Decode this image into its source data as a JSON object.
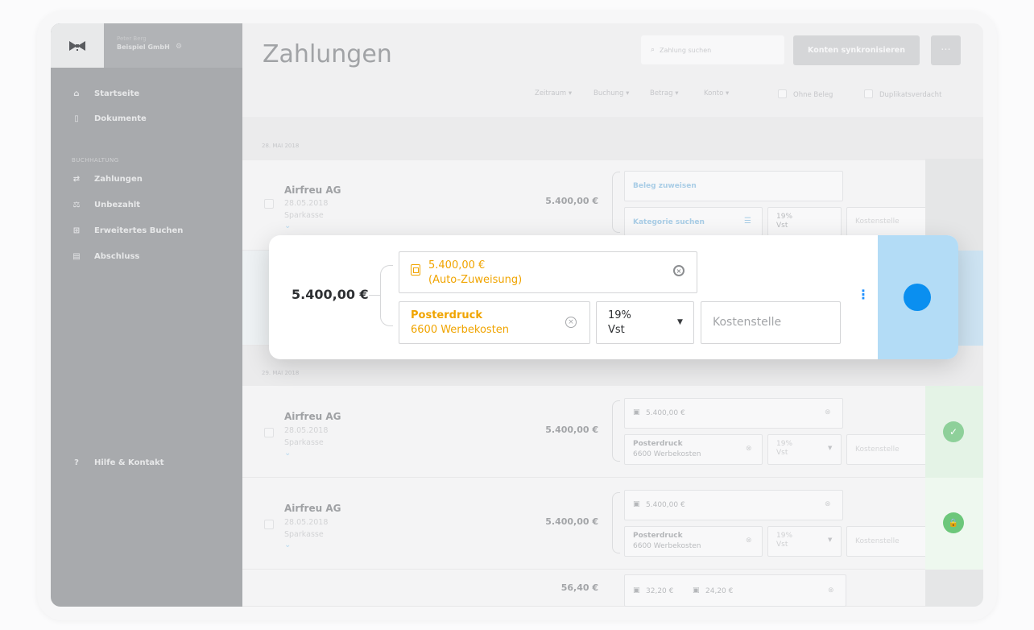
{
  "account": {
    "user": "Peter Berg",
    "company": "Beispiel GmbH"
  },
  "sidebar": {
    "items": [
      {
        "label": "Startseite",
        "icon": "home-icon"
      },
      {
        "label": "Dokumente",
        "icon": "document-icon"
      }
    ],
    "section_label": "BUCHHALTUNG",
    "accounting_items": [
      {
        "label": "Zahlungen",
        "icon": "transfer-icon"
      },
      {
        "label": "Unbezahlt",
        "icon": "scale-icon"
      },
      {
        "label": "Erweitertes Buchen",
        "icon": "grid-icon"
      },
      {
        "label": "Abschluss",
        "icon": "clipboard-icon"
      }
    ],
    "help": "Hilfe & Kontakt"
  },
  "header": {
    "title": "Zahlungen",
    "search_placeholder": "Zahlung suchen",
    "sync_label": "Konten synkronisieren",
    "more_label": "···"
  },
  "filters": {
    "zeitraum": "Zeitraum ▾",
    "buchung": "Buchung ▾",
    "betrag": "Betrag ▾",
    "konto": "Konto ▾",
    "ohne_beleg": "Ohne Beleg",
    "duplikat": "Duplikatsverdacht"
  },
  "sections": [
    "28. MAI 2018",
    "29. MAI 2018"
  ],
  "rows": [
    {
      "vendor": "Airfreu AG",
      "date": "28.05.2018",
      "bank": "Sparkasse",
      "amount": "5.400,00 €",
      "receipt": "Beleg zuweisen",
      "category": "Kategorie suchen",
      "vat_rate": "19%",
      "vat_label": "Vst",
      "cost": "Kostenstelle"
    },
    {
      "vendor": "Airfreu AG",
      "date": "28.05.2018",
      "bank": "Sparkasse",
      "amount": "5.400,00 €",
      "receipt": "5.400,00 €",
      "category": "Posterdruck",
      "account": "6600  Werbekosten",
      "vat_rate": "19%",
      "vat_label": "Vst",
      "cost": "Kostenstelle"
    },
    {
      "vendor": "Airfreu AG",
      "date": "28.05.2018",
      "bank": "Sparkasse",
      "amount": "5.400,00 €",
      "receipt": "5.400,00 €",
      "category": "Posterdruck",
      "account": "6600  Werbekosten",
      "vat_rate": "19%",
      "vat_label": "Vst",
      "cost": "Kostenstelle"
    },
    {
      "amount": "56,40 €",
      "receipt_a": "32,20 €",
      "receipt_b": "24,20 €"
    }
  ],
  "focus_card": {
    "amount": "5.400,00 €",
    "receipt_line1": "5.400,00 €",
    "receipt_line2": "(Auto-Zuweisung)",
    "category": "Posterdruck",
    "account": "6600  Werbekosten",
    "vat_rate": "19%",
    "vat_label": "Vst",
    "cost_placeholder": "Kostenstelle"
  },
  "colors": {
    "accent": "#0a8ff0",
    "highlight": "#f0a400",
    "success": "#6cc77a",
    "sidebar": "#a8aaad"
  }
}
